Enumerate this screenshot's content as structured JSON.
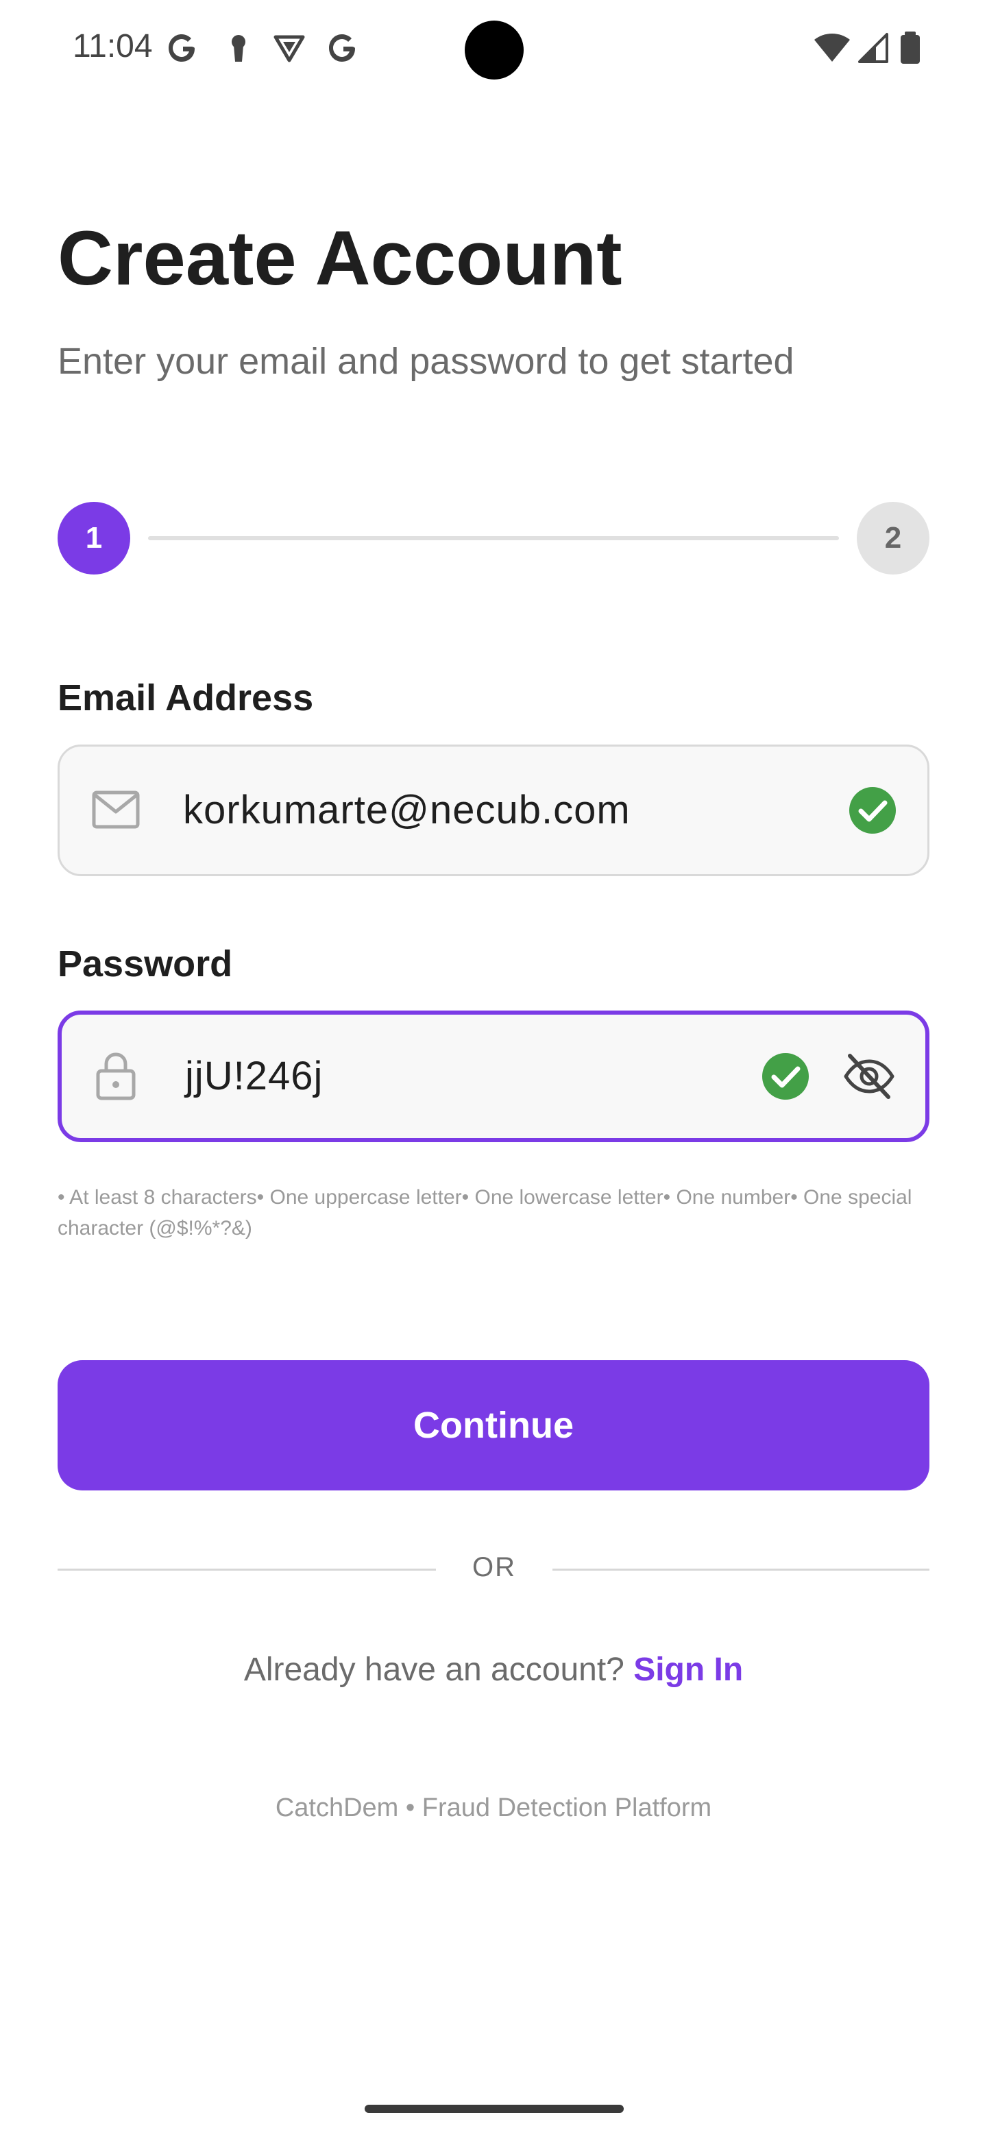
{
  "status_bar": {
    "time": "11:04",
    "icons": [
      "google-icon",
      "keyhole-icon",
      "vpn-shield-icon",
      "google-icon",
      "wifi-icon",
      "cellular-signal-icon",
      "battery-icon"
    ]
  },
  "header": {
    "title": "Create Account",
    "subtitle": "Enter your email and password to get started"
  },
  "stepper": {
    "steps": [
      {
        "label": "1",
        "state": "active"
      },
      {
        "label": "2",
        "state": "inactive"
      }
    ]
  },
  "form": {
    "email": {
      "label": "Email Address",
      "value": "korkumarte@necub.com",
      "icon": "mail-icon",
      "valid": true
    },
    "password": {
      "label": "Password",
      "value": "jjU!246j",
      "icon": "lock-icon",
      "valid": true,
      "visibility_icon": "eye-off-icon",
      "hint": "• At least 8 characters• One uppercase letter• One lowercase letter• One number• One special character (@$!%*?&)"
    },
    "continue_label": "Continue"
  },
  "divider": {
    "text": "OR"
  },
  "signin": {
    "prompt": "Already have an account?",
    "link_label": "Sign In"
  },
  "footer": {
    "text": "CatchDem • Fraud Detection Platform"
  },
  "colors": {
    "accent": "#7b3be6",
    "success": "#43a047",
    "text_primary": "#1f1f1f",
    "text_secondary": "#6b6b6b"
  }
}
